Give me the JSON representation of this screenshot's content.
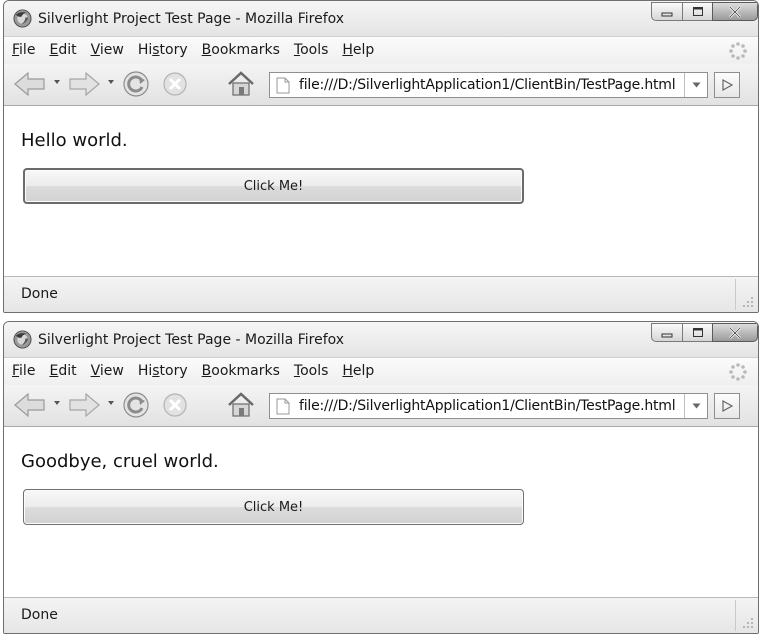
{
  "windows": [
    {
      "title": "Silverlight Project Test Page - Mozilla Firefox",
      "menu": {
        "file": {
          "pre": "",
          "key": "F",
          "post": "ile"
        },
        "edit": {
          "pre": "",
          "key": "E",
          "post": "dit"
        },
        "view": {
          "pre": "",
          "key": "V",
          "post": "iew"
        },
        "history": {
          "pre": "Hi",
          "key": "s",
          "post": "tory"
        },
        "bookmarks": {
          "pre": "",
          "key": "B",
          "post": "ookmarks"
        },
        "tools": {
          "pre": "",
          "key": "T",
          "post": "ools"
        },
        "help": {
          "pre": "",
          "key": "H",
          "post": "elp"
        }
      },
      "url": "file:///D:/SilverlightApplication1/ClientBin/TestPage.html",
      "message": "Hello world.",
      "button_label": "Click Me!",
      "status": "Done"
    },
    {
      "title": "Silverlight Project Test Page - Mozilla Firefox",
      "menu": {
        "file": {
          "pre": "",
          "key": "F",
          "post": "ile"
        },
        "edit": {
          "pre": "",
          "key": "E",
          "post": "dit"
        },
        "view": {
          "pre": "",
          "key": "V",
          "post": "iew"
        },
        "history": {
          "pre": "Hi",
          "key": "s",
          "post": "tory"
        },
        "bookmarks": {
          "pre": "",
          "key": "B",
          "post": "ookmarks"
        },
        "tools": {
          "pre": "",
          "key": "T",
          "post": "ools"
        },
        "help": {
          "pre": "",
          "key": "H",
          "post": "elp"
        }
      },
      "url": "file:///D:/SilverlightApplication1/ClientBin/TestPage.html",
      "message": "Goodbye, cruel world.",
      "button_label": "Click Me!",
      "status": "Done"
    }
  ],
  "icons": {
    "app": "firefox-icon",
    "back": "back-arrow-icon",
    "forward": "forward-arrow-icon",
    "reload": "reload-icon",
    "stop": "stop-icon",
    "home": "home-icon",
    "page": "page-icon",
    "go": "go-arrow-icon",
    "throbber": "throbber-icon",
    "grip": "resize-grip-icon"
  },
  "colors": {
    "chrome": "#e8e8e8",
    "border": "#6f6f6f",
    "close_button": "#a8a8a8"
  }
}
